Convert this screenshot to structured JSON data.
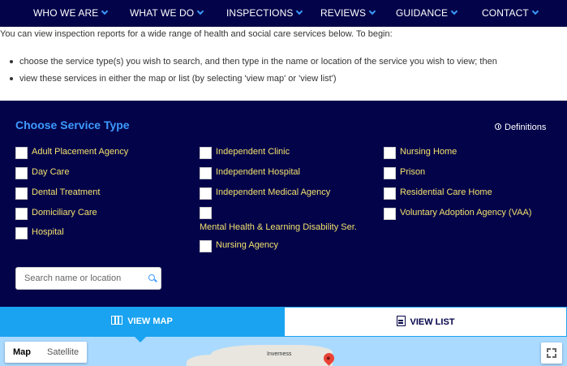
{
  "nav": {
    "items": [
      {
        "label": "WHO WE ARE"
      },
      {
        "label": "WHAT WE DO"
      },
      {
        "label": "INSPECTIONS"
      },
      {
        "label": "REVIEWS"
      },
      {
        "label": "GUIDANCE"
      },
      {
        "label": "CONTACT"
      }
    ]
  },
  "intro": {
    "text": "You can view inspection reports for a wide range of health and social care services below.  To begin:",
    "bullets": [
      "choose the service type(s) you wish to search, and then type in the name or location of the service you wish to view; then",
      "view these services in either the map or list (by selecting 'view map' or 'view list')"
    ]
  },
  "panel": {
    "title": "Choose Service Type",
    "definitions_label": "Definitions",
    "columns": [
      [
        "Adult Placement Agency",
        "Day Care",
        "Dental Treatment",
        "Domiciliary Care",
        "Hospital"
      ],
      [
        "Independent Clinic",
        "Independent Hospital",
        "Independent Medical Agency",
        "Mental Health & Learning Disability Ser.",
        "Nursing Agency"
      ],
      [
        "Nursing Home",
        "Prison",
        "Residential Care Home",
        "Voluntary Adoption Agency (VAA)"
      ]
    ],
    "search_placeholder": "Search name or location"
  },
  "tabs": {
    "map_label": "VIEW MAP",
    "list_label": "VIEW LIST"
  },
  "map": {
    "map_label": "Map",
    "satellite_label": "Satellite",
    "city_label": "Inverness"
  },
  "colors": {
    "navy": "#03034a",
    "accent_blue": "#1aa3f0",
    "title_blue": "#3d9bff",
    "label_yellow": "#f2e16b"
  }
}
